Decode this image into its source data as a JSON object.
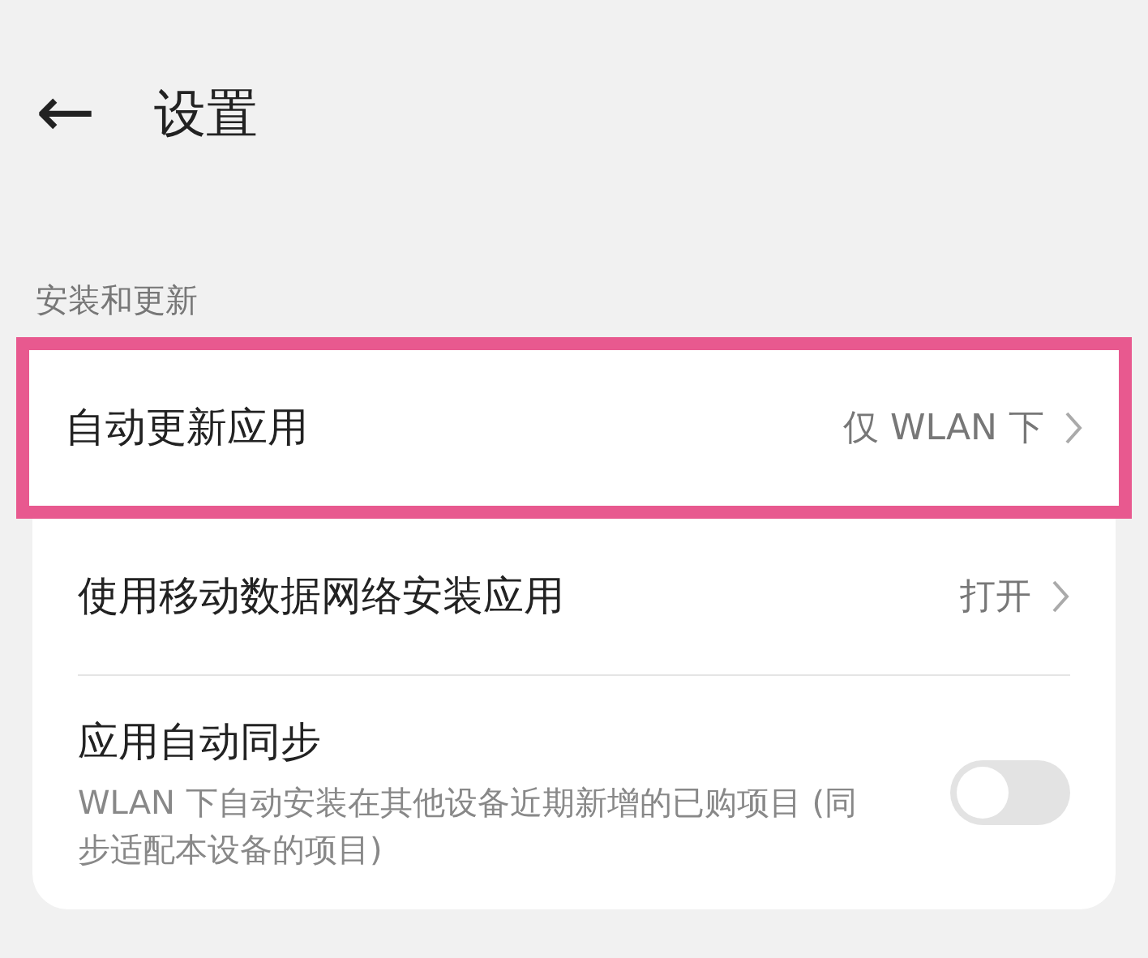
{
  "header": {
    "back": "←",
    "title": "设置"
  },
  "section": {
    "title": "安装和更新"
  },
  "items": [
    {
      "kind": "link",
      "title": "自动更新应用",
      "value": "仅 WLAN 下",
      "highlighted": true
    },
    {
      "kind": "link",
      "title": "使用移动数据网络安装应用",
      "value": "打开",
      "highlighted": false
    },
    {
      "kind": "toggle",
      "title": "应用自动同步",
      "description": "WLAN 下自动安装在其他设备近期新增的已购项目 (同步适配本设备的项目)",
      "on": false,
      "highlighted": false
    }
  ]
}
